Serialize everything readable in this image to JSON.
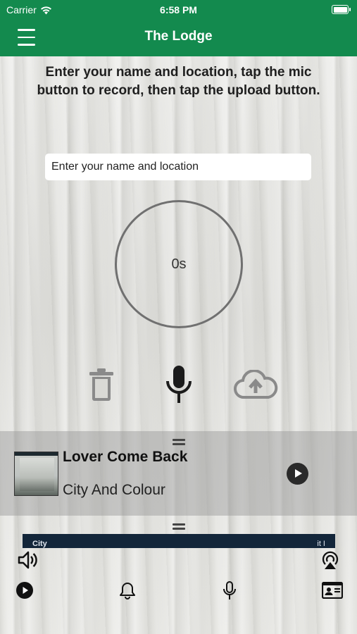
{
  "status": {
    "carrier": "Carrier",
    "time": "6:58 PM",
    "battery_level": 1.0
  },
  "nav": {
    "title": "The Lodge"
  },
  "instructions": "Enter your name and location, tap the mic button to record, then tap the upload button.",
  "name_input": {
    "placeholder": "Enter your name and location",
    "value": ""
  },
  "timer": {
    "label": "0s"
  },
  "mini_player": {
    "title": "Lover Come Back",
    "artist": "City And Colour"
  },
  "video_strip": {
    "left_text": "City",
    "right_text": "it I"
  },
  "icons": {
    "menu": "hamburger-icon",
    "trash": "trash-icon",
    "mic": "microphone-icon",
    "upload": "cloud-upload-icon",
    "play": "play-icon",
    "volume": "speaker-icon",
    "airplay": "airplay-icon",
    "tab_play": "play-circle-icon",
    "tab_bell": "bell-icon",
    "tab_mic": "microphone-icon",
    "tab_card": "contact-card-icon"
  },
  "colors": {
    "brand": "#138a4e",
    "text": "#1e1e1e",
    "ring": "#707070"
  }
}
